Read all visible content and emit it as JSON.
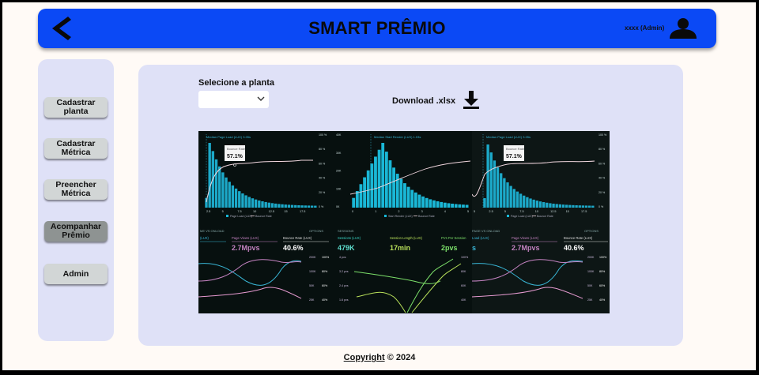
{
  "header": {
    "title": "SMART PRÊMIO",
    "user_label": "xxxx (Admin)"
  },
  "sidebar": {
    "items": [
      {
        "label": "Cadastrar planta"
      },
      {
        "label": "Cadastrar Métrica"
      },
      {
        "label": "Preencher Métrica"
      },
      {
        "label": "Acompanhar Prêmio"
      },
      {
        "label": "Admin"
      }
    ]
  },
  "main": {
    "select_label": "Selecione a planta",
    "select_value": "",
    "download_label": "Download .xlsx"
  },
  "dashboard": {
    "panels": [
      {
        "median_label": "Median Page Load (LUX) 3.05s",
        "tooltip_label": "Bounce Rate",
        "tooltip_value": "57.1%",
        "legend": [
          "Page Load (LUX)",
          "Bounce Rate"
        ],
        "x_ticks": [
          "2.5",
          "5",
          "7.5",
          "10",
          "12.5",
          "15",
          "17.5"
        ],
        "y_right_ticks": [
          "100 %",
          "80 %",
          "60 %",
          "40 %",
          "20 %",
          "0 %"
        ]
      },
      {
        "median_label": "Median Start Render (LUX) 1.03s",
        "legend": [
          "Start Render (LUX)",
          "Bounce Rate"
        ],
        "x_ticks": [
          "0",
          "1",
          "2",
          "3",
          "4",
          "5"
        ],
        "y_left_ticks": [
          "40K",
          "30K",
          "20K",
          "10K",
          "0K"
        ]
      },
      {
        "median_label": "Median Page Load (LUX) 3.05s",
        "tooltip_label": "Bounce Rate",
        "tooltip_value": "57.1%",
        "legend": [
          "Page Load (LUX)",
          "Bounce Rate"
        ],
        "x_ticks": [
          "5",
          "2.5",
          "5",
          "7.5",
          "10",
          "12.5",
          "15",
          "17.5"
        ],
        "y_right_ticks": [
          "100 %",
          "80 %",
          "60 %",
          "40 %",
          "20 %",
          "0 %"
        ]
      }
    ],
    "bottom": [
      {
        "header": "ME VS ONLOAD",
        "options": "OPTIONS",
        "metrics": [
          {
            "label": "(LUX)",
            "value": ""
          },
          {
            "label": "Page Views (LUX)",
            "value": "2.7Mpvs"
          },
          {
            "label": "Bounce Rate (LUX)",
            "value": "40.6%"
          }
        ],
        "ticks": [
          "100%",
          "80%",
          "60%",
          "40%"
        ],
        "left_ticks": [
          "200K",
          "100K",
          "50K",
          "25K"
        ]
      },
      {
        "header": "SESSIONS",
        "metrics": [
          {
            "label": "Sessions (LUX)",
            "value": "479K"
          },
          {
            "label": "Session Length (LUX)",
            "value": "17min"
          },
          {
            "label": "PVs Per Session",
            "value": "2pvs"
          }
        ],
        "ticks": [
          "4 pvs",
          "3.2 pvs",
          "2.4 pvs",
          "1.6 pvs"
        ],
        "right_ticks": [
          "100%",
          "80K",
          "60K",
          "40K"
        ]
      },
      {
        "header": "PAGE VS ONLOAD",
        "options": "OPTIONS",
        "metrics": [
          {
            "label": "Load (LUX)",
            "value": "s"
          },
          {
            "label": "Page Views (LUX)",
            "value": "2.7Mpvs"
          },
          {
            "label": "Bounce Rate (LUX)",
            "value": "40.6%"
          }
        ],
        "ticks": [
          "100%",
          "80%",
          "60%",
          "40%"
        ],
        "left_ticks": [
          "200K",
          "100K",
          "50K",
          "25K"
        ]
      }
    ]
  },
  "footer": {
    "copyright_word": "Copyright",
    "copyright_rest": " © 2024"
  },
  "colors": {
    "header_bg": "#0b49f5",
    "panel_bg": "#dfe1f7",
    "page_bg": "#fffaf6",
    "active_nav": "#8e9392",
    "nav_bg": "#d2d6d6",
    "chart_cyan": "#18b8d8",
    "chart_pink": "#e59ad0",
    "chart_green": "#7ce06a"
  }
}
